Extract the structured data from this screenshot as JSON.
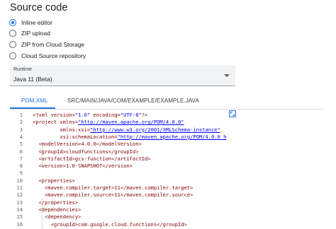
{
  "section_title": "Source code",
  "source_options": [
    {
      "label": "Inline editor",
      "checked": true
    },
    {
      "label": "ZIP upload",
      "checked": false
    },
    {
      "label": "ZIP from Cloud Storage",
      "checked": false
    },
    {
      "label": "Cloud Source repository",
      "checked": false
    }
  ],
  "runtime": {
    "label": "Runtime",
    "value": "Java 11 (Beta)"
  },
  "tabs": {
    "active": "POM.XML",
    "inactive": "SRC/MAIN/JAVA/COM/EXAMPLE/EXAMPLE.JAVA"
  },
  "code_lines": [
    {
      "n": "1",
      "text": "<?xml version=\"1.0\" encoding=\"UTF-8\"?>"
    },
    {
      "n": "2",
      "text": "<project xmlns=\"http://maven.apache.org/POM/4.0.0\""
    },
    {
      "n": "3",
      "text": "         xmlns:xsi=\"http://www.w3.org/2001/XMLSchema-instance\""
    },
    {
      "n": "4",
      "text": "         xsi:schemaLocation=\"http://maven.apache.org/POM/4.0.0 h"
    },
    {
      "n": "5",
      "text": "  <modelVersion>4.0.0</modelVersion>"
    },
    {
      "n": "6",
      "text": "  <groupId>cloudfunctions</groupId>"
    },
    {
      "n": "7",
      "text": "  <artifactId>gcs-function</artifactId>"
    },
    {
      "n": "8",
      "text": "  <version>1.0-SNAPSHOT</version>"
    },
    {
      "n": "9",
      "text": ""
    },
    {
      "n": "10",
      "text": "  <properties>"
    },
    {
      "n": "11",
      "text": "    <maven.compiler.target>11</maven.compiler.target>"
    },
    {
      "n": "12",
      "text": "    <maven.compiler.source>11</maven.compiler.source>"
    },
    {
      "n": "13",
      "text": "  </properties>"
    },
    {
      "n": "14",
      "text": "  <dependencies>"
    },
    {
      "n": "15",
      "text": "    <dependency>"
    },
    {
      "n": "16",
      "text": "      <groupId>com.google.cloud.functions</groupId>"
    }
  ],
  "colors": {
    "accent": "#1a73e8",
    "code_tag": "#800000",
    "code_string": "#0000ff"
  }
}
